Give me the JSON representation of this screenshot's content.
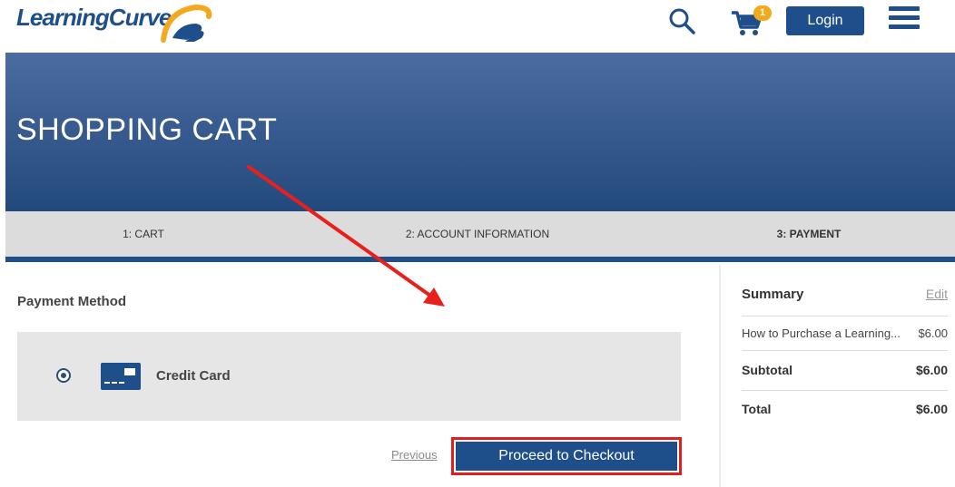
{
  "header": {
    "logo_text": "LearningCurve",
    "cart_count": "1",
    "login_label": "Login",
    "icons": [
      "search-icon",
      "cart-icon",
      "menu-icon"
    ]
  },
  "hero": {
    "title": "SHOPPING CART"
  },
  "steps": [
    {
      "label": "1: CART",
      "active": false
    },
    {
      "label": "2: ACCOUNT INFORMATION",
      "active": false
    },
    {
      "label": "3: PAYMENT",
      "active": true
    }
  ],
  "payment": {
    "heading": "Payment Method",
    "option_label": "Credit Card",
    "option_selected": true,
    "previous_label": "Previous",
    "checkout_label": "Proceed to Checkout"
  },
  "summary": {
    "heading": "Summary",
    "edit_label": "Edit",
    "item_name": "How to Purchase a Learning...",
    "item_price": "$6.00",
    "subtotal_label": "Subtotal",
    "subtotal_value": "$6.00",
    "total_label": "Total",
    "total_value": "$6.00"
  },
  "colors": {
    "brand_blue": "#1f4f8a",
    "badge_orange": "#f4a81d",
    "highlight_red": "#e02020",
    "step_bar": "#dcdcdc"
  }
}
